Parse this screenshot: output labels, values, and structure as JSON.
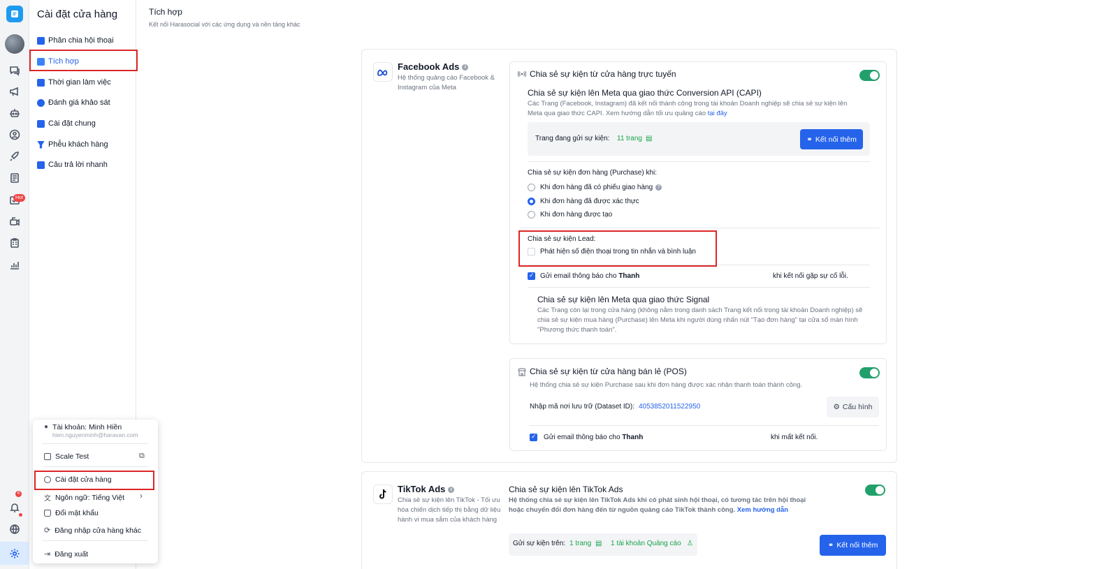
{
  "sidebar": {
    "title": "Cài đặt cửa hàng",
    "items": [
      {
        "label": "Phân chia hội thoại"
      },
      {
        "label": "Tích hợp"
      },
      {
        "label": "Thời gian làm việc"
      },
      {
        "label": "Đánh giá khảo sát"
      },
      {
        "label": "Cài đặt chung"
      },
      {
        "label": "Phễu khách hàng"
      },
      {
        "label": "Câu trả lời nhanh"
      }
    ]
  },
  "rail": {
    "hot_badge": "Hot",
    "notif_count": "6"
  },
  "header": {
    "title": "Tích hợp",
    "subtitle": "Kết nối Harasocial với các ứng dụng và nền tảng khác"
  },
  "facebook": {
    "name": "Facebook Ads",
    "desc": "Hệ thống quảng cáo Facebook & Instagram của Meta",
    "online": {
      "title": "Chia sẻ sự kiện từ cửa hàng trực tuyến",
      "capi_title": "Chia sẻ sự kiện lên Meta qua giao thức Conversion API (CAPI)",
      "capi_desc": "Các Trang (Facebook, Instagram) đã kết nối thành công trong tài khoản Doanh nghiệp sẽ chia sẻ sự kiện lên Meta qua giao thức CAPI. Xem hướng dẫn tối ưu quảng cáo",
      "capi_link": "tại đây",
      "sending_label": "Trang đang gửi sự kiện:",
      "sending_value": "11 trang",
      "connect_more": "Kết nối thêm",
      "purchase_label": "Chia sẻ sự kiện đơn hàng (Purchase) khi:",
      "purchase_options": [
        {
          "label": "Khi đơn hàng đã có phiếu giao hàng",
          "selected": false
        },
        {
          "label": "Khi đơn hàng đã được xác thực",
          "selected": true
        },
        {
          "label": "Khi đơn hàng được tạo",
          "selected": false
        }
      ],
      "lead_label": "Chia sẻ sự kiện Lead:",
      "lead_option": "Phát hiện số điện thoại trong tin nhắn và bình luận",
      "email_prefix": "Gửi email thông báo cho",
      "email_name": "Thanh",
      "email_suffix": "khi kết nối gặp sự cố lỗi.",
      "signal_title": "Chia sẻ sự kiện lên Meta qua giao thức Signal",
      "signal_desc": "Các Trang còn lại trong cửa hàng (không nằm trong danh sách Trang kết nối trong tài khoản Doanh nghiệp) sẽ chia sẻ sự kiện mua hàng (Purchase) lên Meta khi người dùng nhấn nút \"Tạo đơn hàng\" tại cửa sổ màn hình \"Phương thức thanh toán\"."
    },
    "pos": {
      "title": "Chia sẻ sự kiện từ cửa hàng bán lẻ (POS)",
      "desc": "Hệ thống chia sẻ sự kiện Purchase sau khi đơn hàng được xác nhận thanh toán thành công.",
      "dataset_label": "Nhập mã nơi lưu trữ (Dataset ID):",
      "dataset_value": "4053852011522950",
      "config_button": "Cấu hình",
      "email_prefix": "Gửi email thông báo cho",
      "email_name": "Thanh",
      "email_suffix": "khi mất kết nối."
    }
  },
  "tiktok": {
    "name": "TikTok Ads",
    "desc": "Chia sẻ sự kiện lên TikTok - Tối ưu hóa chiến dịch tiếp thị bằng dữ liệu hành vi mua sắm của khách hàng",
    "title": "Chia sẻ sự kiện lên TikTok Ads",
    "body": "Hệ thống chia sẻ sự kiện lên TikTok Ads khi có phát sinh hội thoại, có tương tác trên hội thoại hoặc chuyển đổi đơn hàng đến từ nguồn quảng cáo TikTok thành công.",
    "guide_link": "Xem hướng dẫn",
    "send_label": "Gửi sự kiện trên:",
    "pages": "1 trang",
    "ad_accounts": "1 tài khoản Quảng cáo",
    "connect_more": "Kết nối thêm"
  },
  "popup": {
    "account": "Tài khoản: Minh Hiền",
    "email": "hien.nguyenminh@haravan.com",
    "store": "Scale Test",
    "settings": "Cài đặt cửa hàng",
    "language": "Ngôn ngữ: Tiếng Việt",
    "change_password": "Đổi mật khẩu",
    "switch_store": "Đăng nhập cửa hàng khác",
    "logout": "Đăng xuất"
  }
}
